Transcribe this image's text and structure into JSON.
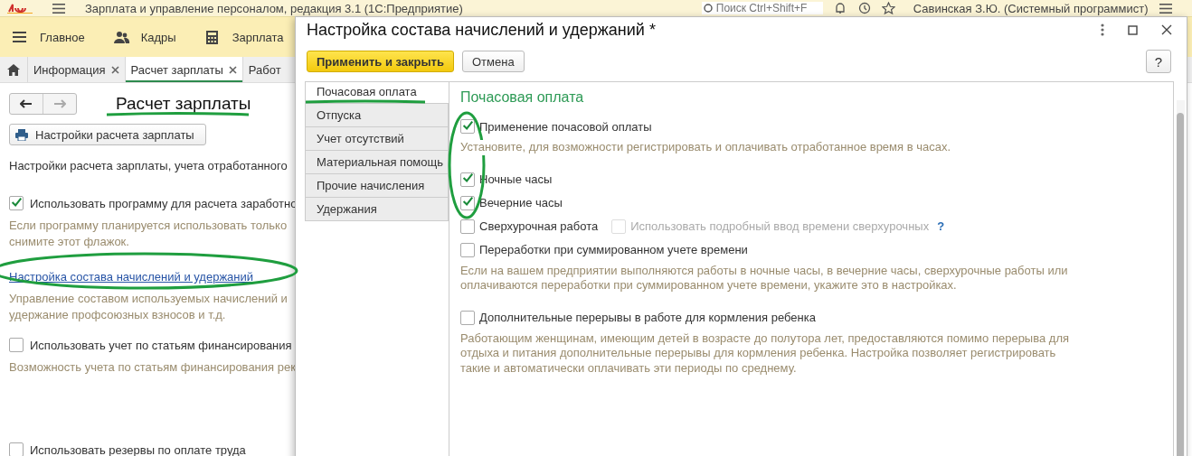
{
  "app_bar": {
    "title": "Зарплата и управление персоналом, редакция 3.1  (1С:Предприятие)",
    "search": {
      "placeholder": "Поиск Ctrl+Shift+F"
    },
    "user": "Савинская З.Ю. (Системный программист)"
  },
  "sections": [
    {
      "label": "Главное"
    },
    {
      "label": "Кадры"
    },
    {
      "label": "Зарплата"
    }
  ],
  "open_tabs": [
    {
      "label": "Информация",
      "selected": false,
      "closable": true
    },
    {
      "label": "Расчет зарплаты",
      "selected": true,
      "closable": true
    },
    {
      "label": "Работ",
      "selected": false,
      "closable": false
    }
  ],
  "page": {
    "title": "Расчет зарплаты",
    "settings_button": "Настройки расчета зарплаты",
    "items": [
      {
        "kind": "text",
        "text": [
          "Настройки расчета зарплаты, учета отработанного"
        ]
      },
      {
        "kind": "checkbox",
        "label": "Использовать программу для расчета заработно",
        "checked": true
      },
      {
        "kind": "note",
        "text": [
          "Если программу планируется использовать только",
          "снимите этот флажок."
        ]
      },
      {
        "kind": "link",
        "label": "Настройка состава начислений и удержаний"
      },
      {
        "kind": "note",
        "text": [
          "Управление составом используемых начислений и",
          "удержание профсоюзных взносов и т.д."
        ]
      },
      {
        "kind": "checkbox",
        "label": "Использовать учет по статьям финансирования",
        "checked": false
      },
      {
        "kind": "note",
        "text": [
          "Возможность учета по статьям финансирования рек"
        ]
      },
      {
        "kind": "spacer"
      },
      {
        "kind": "checkbox",
        "label": "Использовать резервы по оплате труда",
        "checked": false
      }
    ]
  },
  "dialog": {
    "title": "Настройка состава начислений и удержаний *",
    "buttons": [
      {
        "label": "Применить и закрыть",
        "kind": "primary"
      },
      {
        "label": "Отмена",
        "kind": "normal"
      }
    ],
    "help_button": "?",
    "tabs": [
      {
        "label": "Почасовая оплата",
        "selected": true
      },
      {
        "label": "Отпуска",
        "selected": false
      },
      {
        "label": "Учет отсутствий",
        "selected": false
      },
      {
        "label": "Материальная помощь",
        "selected": false
      },
      {
        "label": "Прочие начисления",
        "selected": false
      },
      {
        "label": "Удержания",
        "selected": false
      }
    ],
    "heading": "Почасовая оплата",
    "options": [
      {
        "kind": "checkbox",
        "label": "Применение почасовой оплаты",
        "checked": true
      },
      {
        "kind": "note",
        "text": "Установите, для возможности регистрировать и оплачивать отработанное время в часах."
      },
      {
        "kind": "checkbox",
        "label": "Ночные часы",
        "checked": true
      },
      {
        "kind": "checkbox",
        "label": "Вечерние часы",
        "checked": true
      },
      {
        "kind": "checkbox",
        "label": "Сверхурочная работа",
        "checked": false,
        "sub": {
          "label": "Использовать подробный ввод времени сверхурочных",
          "checked": false,
          "disabled": true,
          "help": "?"
        }
      },
      {
        "kind": "checkbox",
        "label": "Переработки при суммированном учете времени",
        "checked": false
      },
      {
        "kind": "note",
        "text": "Если на вашем предприятии выполняются работы в ночные часы, в вечерние часы, сверхурочные работы или оплачиваются переработки при суммированном учете времени, укажите это в настройках."
      },
      {
        "kind": "checkbox",
        "label": "Дополнительные перерывы в работе для кормления ребенка",
        "checked": false
      },
      {
        "kind": "note",
        "text": "Работающим женщинам, имеющим детей в возрасте до полутора лет, предоставляются помимо перерыва для отдыха и питания дополнительные перерывы для кормления ребенка. Настройка позволяет регистрировать такие и автоматически оплачивать эти периоды по среднему."
      }
    ]
  }
}
